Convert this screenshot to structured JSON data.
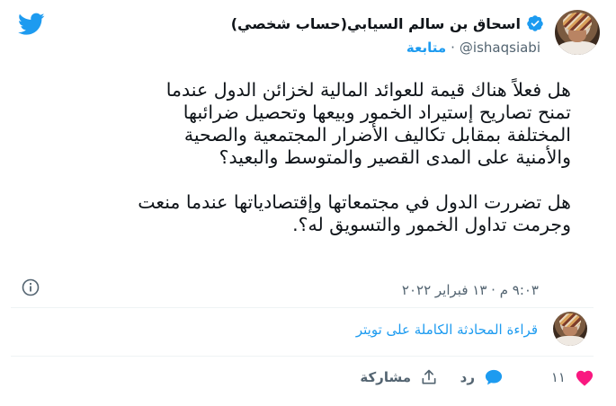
{
  "author": {
    "name": "اسحاق بن سالم السيابي(حساب شخصي)",
    "handle": "@ishaqsiabi",
    "separator": "·",
    "follow_label": "متابعة"
  },
  "tweet": {
    "text": "هل فعلاً هناك قيمة للعوائد المالية لخزائن الدول عندما\nتمنح تصاريح إستيراد الخمور وبيعها وتحصيل ضرائبها\nالمختلفة بمقابل تكاليف الأضرار المجتمعية والصحية\nوالأمنية على المدى القصير والمتوسط والبعيد؟\n\nهل تضررت الدول في مجتمعاتها وإقتصادياتها عندما منعت\nوجرمت تداول الخمور والتسويق له؟.",
    "timestamp": "٩:٠٣ م · ١٣ فبراير ٢٠٢٢"
  },
  "conversation": {
    "read_label": "قراءة المحادثة الكاملة على تويتر"
  },
  "actions": {
    "like_count": "١١",
    "reply_label": "رد",
    "share_label": "مشاركة"
  },
  "colors": {
    "brand": "#1d9bf0",
    "like": "#f91880",
    "muted": "#536471"
  },
  "icons": {
    "logo": "twitter-bird-icon",
    "verified": "verified-badge-icon",
    "info": "info-icon",
    "like": "heart-icon",
    "reply": "speech-bubble-icon",
    "share": "share-upload-icon"
  }
}
